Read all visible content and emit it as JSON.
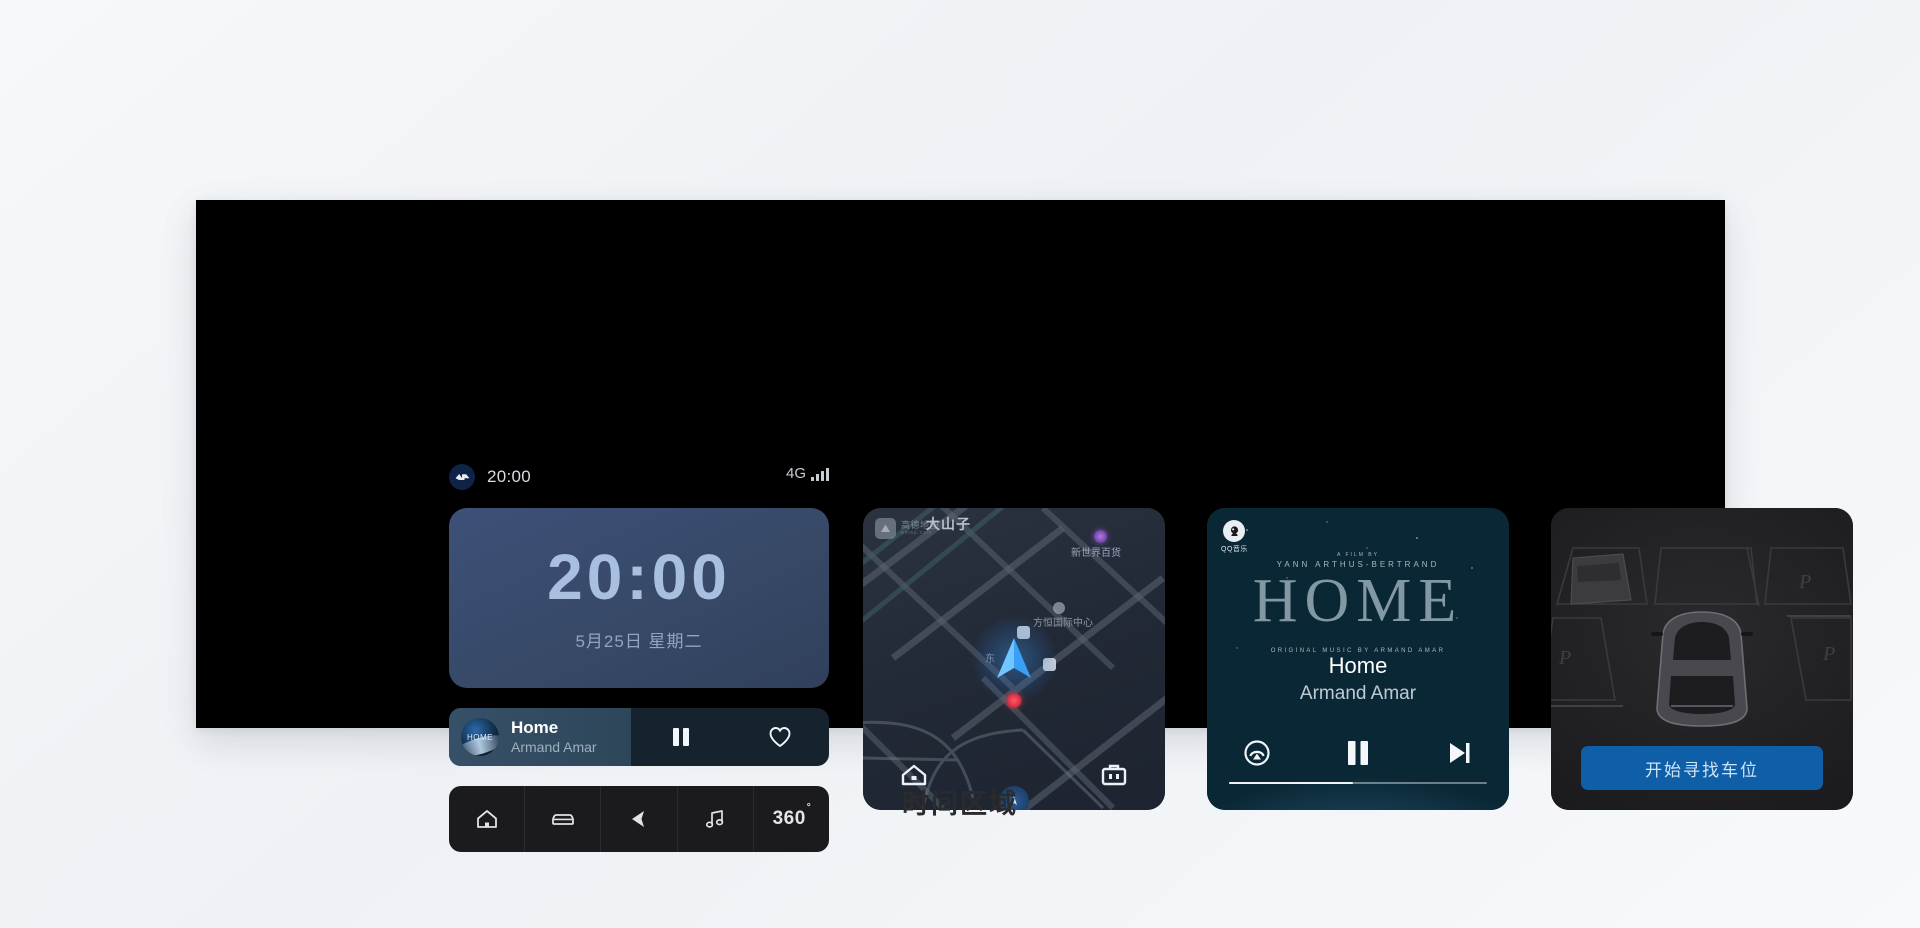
{
  "caption": "时间区域",
  "statusbar": {
    "app_icon": "brand-app-icon",
    "time": "20:00",
    "network": "4G",
    "signal_icon": "signal-bars-icon"
  },
  "clock_widget": {
    "time": "20:00",
    "date": "5月25日  星期二"
  },
  "mini_player": {
    "album_art_label": "HOME",
    "title": "Home",
    "artist": "Armand Amar",
    "pause_icon": "pause-icon",
    "favorite_icon": "heart-icon"
  },
  "dock": {
    "items": [
      {
        "name": "home",
        "icon": "home-icon",
        "label": ""
      },
      {
        "name": "car",
        "icon": "car-icon",
        "label": ""
      },
      {
        "name": "navigation",
        "icon": "navigation-arrow-icon",
        "label": ""
      },
      {
        "name": "music",
        "icon": "music-note-icon",
        "label": ""
      },
      {
        "name": "surround-view",
        "icon": "360-text",
        "label": "360",
        "sup": "°"
      }
    ]
  },
  "map_card": {
    "logo_cn": "高德地图",
    "logo_en": "amap.com",
    "district_label": "大山子",
    "poi_1": "新世界百货",
    "poi_2": "方恒国际中心",
    "direction_label": "东",
    "shortcut_home_icon": "house-icon",
    "shortcut_work_icon": "briefcase-icon",
    "position_icon": "navigation-arrow-icon",
    "compass_icon": "compass-icon"
  },
  "music_card": {
    "qq_label": "QQ音乐",
    "poster_credit_top": "A FILM BY",
    "poster_credit_director": "YANN ARTHUS-BERTRAND",
    "poster_title": "HOME",
    "poster_credit_music": "ORIGINAL MUSIC BY ARMAND AMAR",
    "title": "Home",
    "artist": "Armand Amar",
    "cast_icon": "cast-icon",
    "pause_icon": "pause-icon",
    "next_icon": "next-track-icon",
    "progress_percent": 48
  },
  "parking_card": {
    "button_label": "开始寻找车位",
    "slot_label": "P",
    "car_icon": "car-top-view-icon"
  },
  "colors": {
    "panel_bg": "#000000",
    "clock_card": "#3a4c71",
    "clock_text": "#a9bfe0",
    "mini_player_bg": "#16222e",
    "dock_bg": "#1b1b1d",
    "park_button": "#0f5ea8",
    "accent_blue": "#2f8fe8"
  }
}
